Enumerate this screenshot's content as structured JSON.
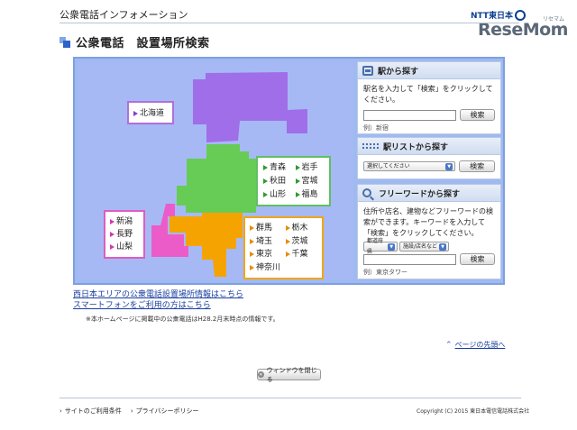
{
  "header": {
    "site_title": "公衆電話インフォメーション",
    "ntt_logo": "NTT東日本",
    "watermark_jp": "リセマム",
    "watermark_en": "ReseMom"
  },
  "page": {
    "heading": "公衆電話　設置場所検索"
  },
  "map": {
    "regions": {
      "hokkaido": {
        "color": "#a06ee8",
        "labels": [
          "北海道"
        ]
      },
      "tohoku": {
        "color": "#66cc55",
        "labels": [
          "青森",
          "岩手",
          "秋田",
          "宮城",
          "山形",
          "福島"
        ]
      },
      "kanto": {
        "color": "#f5a300",
        "labels": [
          "群馬",
          "栃木",
          "埼玉",
          "茨城",
          "東京",
          "千葉",
          "神奈川"
        ]
      },
      "shinetsu": {
        "color": "#ec5cc8",
        "labels": [
          "新潟",
          "長野",
          "山梨"
        ]
      }
    }
  },
  "station_search": {
    "title": "駅から探す",
    "icon": "train-icon",
    "description": "駅名を入力して「検索」をクリックしてください。",
    "input_value": "",
    "button": "検索",
    "example": "例）新宿"
  },
  "station_list": {
    "title": "駅リストから探す",
    "icon": "list-icon",
    "select_value": "選択してください",
    "button": "検索"
  },
  "freeword_search": {
    "title": "フリーワードから探す",
    "icon": "search-icon",
    "description": "住所や店名、建物などフリーワードの検索ができます。キーワードを入力して「検索」をクリックしてください。",
    "select_pref": "都道府県",
    "select_category": "施設/店名など",
    "input_value": "",
    "button": "検索",
    "example": "例）東京タワー"
  },
  "links": {
    "west_japan": "西日本エリアの公衆電話設置場所情報はこちら",
    "smartphone": "スマートフォンをご利用の方はこちら"
  },
  "notice": "※本ホームページに掲載中の公衆電話はH28.2月末時点の情報です。",
  "page_top": "ページの先頭へ",
  "close_button": "ウィンドウを閉じる",
  "footer": {
    "terms": "サイトのご利用条件",
    "privacy": "プライバシーポリシー",
    "copyright": "Copyright (C) 2015 東日本電信電話株式会社"
  }
}
